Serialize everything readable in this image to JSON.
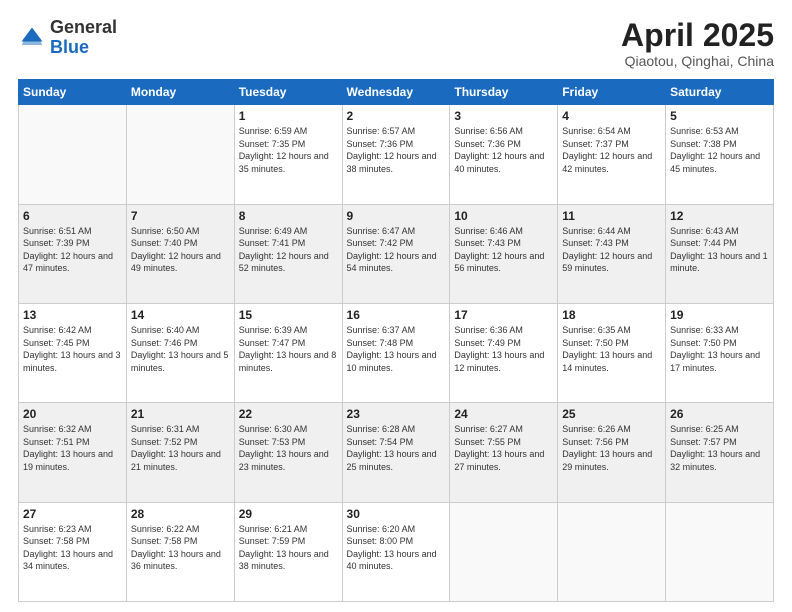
{
  "header": {
    "logo_general": "General",
    "logo_blue": "Blue",
    "title": "April 2025",
    "location": "Qiaotou, Qinghai, China"
  },
  "weekdays": [
    "Sunday",
    "Monday",
    "Tuesday",
    "Wednesday",
    "Thursday",
    "Friday",
    "Saturday"
  ],
  "weeks": [
    [
      {
        "day": "",
        "info": ""
      },
      {
        "day": "",
        "info": ""
      },
      {
        "day": "1",
        "info": "Sunrise: 6:59 AM\nSunset: 7:35 PM\nDaylight: 12 hours and 35 minutes."
      },
      {
        "day": "2",
        "info": "Sunrise: 6:57 AM\nSunset: 7:36 PM\nDaylight: 12 hours and 38 minutes."
      },
      {
        "day": "3",
        "info": "Sunrise: 6:56 AM\nSunset: 7:36 PM\nDaylight: 12 hours and 40 minutes."
      },
      {
        "day": "4",
        "info": "Sunrise: 6:54 AM\nSunset: 7:37 PM\nDaylight: 12 hours and 42 minutes."
      },
      {
        "day": "5",
        "info": "Sunrise: 6:53 AM\nSunset: 7:38 PM\nDaylight: 12 hours and 45 minutes."
      }
    ],
    [
      {
        "day": "6",
        "info": "Sunrise: 6:51 AM\nSunset: 7:39 PM\nDaylight: 12 hours and 47 minutes."
      },
      {
        "day": "7",
        "info": "Sunrise: 6:50 AM\nSunset: 7:40 PM\nDaylight: 12 hours and 49 minutes."
      },
      {
        "day": "8",
        "info": "Sunrise: 6:49 AM\nSunset: 7:41 PM\nDaylight: 12 hours and 52 minutes."
      },
      {
        "day": "9",
        "info": "Sunrise: 6:47 AM\nSunset: 7:42 PM\nDaylight: 12 hours and 54 minutes."
      },
      {
        "day": "10",
        "info": "Sunrise: 6:46 AM\nSunset: 7:43 PM\nDaylight: 12 hours and 56 minutes."
      },
      {
        "day": "11",
        "info": "Sunrise: 6:44 AM\nSunset: 7:43 PM\nDaylight: 12 hours and 59 minutes."
      },
      {
        "day": "12",
        "info": "Sunrise: 6:43 AM\nSunset: 7:44 PM\nDaylight: 13 hours and 1 minute."
      }
    ],
    [
      {
        "day": "13",
        "info": "Sunrise: 6:42 AM\nSunset: 7:45 PM\nDaylight: 13 hours and 3 minutes."
      },
      {
        "day": "14",
        "info": "Sunrise: 6:40 AM\nSunset: 7:46 PM\nDaylight: 13 hours and 5 minutes."
      },
      {
        "day": "15",
        "info": "Sunrise: 6:39 AM\nSunset: 7:47 PM\nDaylight: 13 hours and 8 minutes."
      },
      {
        "day": "16",
        "info": "Sunrise: 6:37 AM\nSunset: 7:48 PM\nDaylight: 13 hours and 10 minutes."
      },
      {
        "day": "17",
        "info": "Sunrise: 6:36 AM\nSunset: 7:49 PM\nDaylight: 13 hours and 12 minutes."
      },
      {
        "day": "18",
        "info": "Sunrise: 6:35 AM\nSunset: 7:50 PM\nDaylight: 13 hours and 14 minutes."
      },
      {
        "day": "19",
        "info": "Sunrise: 6:33 AM\nSunset: 7:50 PM\nDaylight: 13 hours and 17 minutes."
      }
    ],
    [
      {
        "day": "20",
        "info": "Sunrise: 6:32 AM\nSunset: 7:51 PM\nDaylight: 13 hours and 19 minutes."
      },
      {
        "day": "21",
        "info": "Sunrise: 6:31 AM\nSunset: 7:52 PM\nDaylight: 13 hours and 21 minutes."
      },
      {
        "day": "22",
        "info": "Sunrise: 6:30 AM\nSunset: 7:53 PM\nDaylight: 13 hours and 23 minutes."
      },
      {
        "day": "23",
        "info": "Sunrise: 6:28 AM\nSunset: 7:54 PM\nDaylight: 13 hours and 25 minutes."
      },
      {
        "day": "24",
        "info": "Sunrise: 6:27 AM\nSunset: 7:55 PM\nDaylight: 13 hours and 27 minutes."
      },
      {
        "day": "25",
        "info": "Sunrise: 6:26 AM\nSunset: 7:56 PM\nDaylight: 13 hours and 29 minutes."
      },
      {
        "day": "26",
        "info": "Sunrise: 6:25 AM\nSunset: 7:57 PM\nDaylight: 13 hours and 32 minutes."
      }
    ],
    [
      {
        "day": "27",
        "info": "Sunrise: 6:23 AM\nSunset: 7:58 PM\nDaylight: 13 hours and 34 minutes."
      },
      {
        "day": "28",
        "info": "Sunrise: 6:22 AM\nSunset: 7:58 PM\nDaylight: 13 hours and 36 minutes."
      },
      {
        "day": "29",
        "info": "Sunrise: 6:21 AM\nSunset: 7:59 PM\nDaylight: 13 hours and 38 minutes."
      },
      {
        "day": "30",
        "info": "Sunrise: 6:20 AM\nSunset: 8:00 PM\nDaylight: 13 hours and 40 minutes."
      },
      {
        "day": "",
        "info": ""
      },
      {
        "day": "",
        "info": ""
      },
      {
        "day": "",
        "info": ""
      }
    ]
  ]
}
